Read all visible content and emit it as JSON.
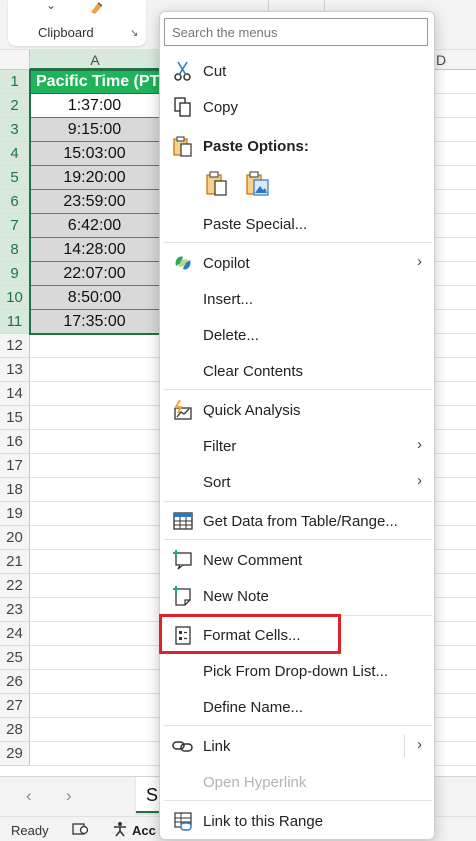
{
  "ribbon": {
    "group_label": "Clipboard"
  },
  "columns": {
    "a": "A",
    "d": "D"
  },
  "rows": [
    "1",
    "2",
    "3",
    "4",
    "5",
    "6",
    "7",
    "8",
    "9",
    "10",
    "11",
    "12",
    "13",
    "14",
    "15",
    "16",
    "17",
    "18",
    "19",
    "20",
    "21",
    "22",
    "23",
    "24",
    "25",
    "26",
    "27",
    "28",
    "29"
  ],
  "table": {
    "header": "Pacific Time (PT)",
    "values": [
      "1:37:00",
      "9:15:00",
      "15:03:00",
      "19:20:00",
      "23:59:00",
      "6:42:00",
      "14:28:00",
      "22:07:00",
      "8:50:00",
      "17:35:00"
    ]
  },
  "sheet": {
    "tab_visible_text": "S"
  },
  "status": {
    "ready": "Ready",
    "accessibility_partial": "Acc"
  },
  "menu": {
    "search_placeholder": "Search the menus",
    "items": {
      "cut": "Cut",
      "copy": "Copy",
      "paste_options": "Paste Options:",
      "paste_special": "Paste Special...",
      "copilot": "Copilot",
      "insert": "Insert...",
      "delete": "Delete...",
      "clear_contents": "Clear Contents",
      "quick_analysis": "Quick Analysis",
      "filter": "Filter",
      "sort": "Sort",
      "get_data": "Get Data from Table/Range...",
      "new_comment": "New Comment",
      "new_note": "New Note",
      "format_cells": "Format Cells...",
      "pick_from_list": "Pick From Drop-down List...",
      "define_name": "Define Name...",
      "link": "Link",
      "open_hyperlink": "Open Hyperlink",
      "link_to_range": "Link to this Range"
    }
  },
  "colors": {
    "header_fill": "#1fb35b",
    "cell_fill": "#d9d9d9",
    "excel_green": "#217346",
    "highlight_red": "#e0202b"
  }
}
